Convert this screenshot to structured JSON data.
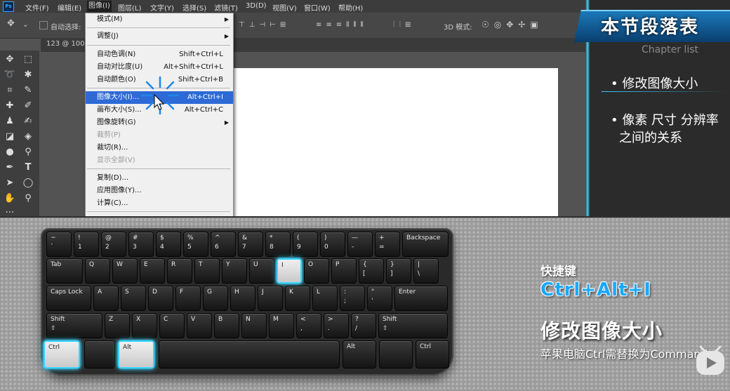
{
  "menubar": {
    "logo": "Ps",
    "items": [
      "文件(F)",
      "编辑(E)",
      "图像(I)",
      "图层(L)",
      "文字(Y)",
      "选择(S)",
      "滤镜(T)",
      "3D(D)",
      "视图(V)",
      "窗口(W)",
      "帮助(H)"
    ]
  },
  "options": {
    "auto_select": "自动选择:",
    "mode_3d": "3D 模式:"
  },
  "document": {
    "tab": "123 @ 100"
  },
  "image_menu": {
    "items": [
      {
        "label": "模式(M)",
        "shortcut": "",
        "submenu": true,
        "disabled": false
      },
      {
        "label": "调整(J)",
        "shortcut": "",
        "submenu": true,
        "disabled": false
      },
      {
        "label": "自动色调(N)",
        "shortcut": "Shift+Ctrl+L",
        "disabled": false
      },
      {
        "label": "自动对比度(U)",
        "shortcut": "Alt+Shift+Ctrl+L",
        "disabled": false
      },
      {
        "label": "自动颜色(O)",
        "shortcut": "Shift+Ctrl+B",
        "disabled": false
      },
      {
        "label": "图像大小(I)...",
        "shortcut": "Alt+Ctrl+I",
        "highlighted": true,
        "disabled": false
      },
      {
        "label": "画布大小(S)...",
        "shortcut": "Alt+Ctrl+C",
        "disabled": false
      },
      {
        "label": "图像旋转(G)",
        "shortcut": "",
        "submenu": true,
        "disabled": false
      },
      {
        "label": "裁剪(P)",
        "shortcut": "",
        "disabled": true
      },
      {
        "label": "裁切(R)...",
        "shortcut": "",
        "disabled": false
      },
      {
        "label": "显示全部(V)",
        "shortcut": "",
        "disabled": true
      },
      {
        "label": "复制(D)...",
        "shortcut": "",
        "disabled": false
      },
      {
        "label": "应用图像(Y)...",
        "shortcut": "",
        "disabled": false
      },
      {
        "label": "计算(C)...",
        "shortcut": "",
        "disabled": false
      }
    ]
  },
  "panel": {
    "title": "本节段落表",
    "subtitle": "Chapter list",
    "chapters": [
      "• 修改图像大小",
      "• 像素 尺寸 分辨率",
      "之间的关系"
    ]
  },
  "keyboard": {
    "row1": [
      [
        "~",
        "`"
      ],
      [
        "!",
        "1"
      ],
      [
        "@",
        "2"
      ],
      [
        "#",
        "3"
      ],
      [
        "$",
        "4"
      ],
      [
        "%",
        "5"
      ],
      [
        "^",
        "6"
      ],
      [
        "&",
        "7"
      ],
      [
        "*",
        "8"
      ],
      [
        "(",
        "9"
      ],
      [
        ")",
        "0"
      ],
      [
        "—",
        "-"
      ],
      [
        "+",
        "="
      ]
    ],
    "backspace": "Backspace",
    "tab": "Tab",
    "row2": [
      "Q",
      "W",
      "E",
      "R",
      "T",
      "Y",
      "U",
      "I",
      "O",
      "P"
    ],
    "row2_extra": [
      [
        "{",
        "["
      ],
      [
        "}",
        "]"
      ],
      [
        "|",
        "\\"
      ]
    ],
    "caps": "Caps Lock",
    "row3": [
      "A",
      "S",
      "D",
      "F",
      "G",
      "H",
      "J",
      "K",
      "L"
    ],
    "row3_extra": [
      [
        ":",
        ";"
      ],
      [
        "\"",
        "'"
      ]
    ],
    "enter": "Enter",
    "shift": "Shift",
    "row4": [
      "Z",
      "X",
      "C",
      "V",
      "B",
      "N",
      "M"
    ],
    "row4_extra": [
      [
        "<",
        ","
      ],
      [
        ">",
        "."
      ],
      [
        "?",
        "/"
      ]
    ],
    "ctrl": "Ctrl",
    "alt": "Alt",
    "shift_symbol": "⇧"
  },
  "shortcut": {
    "label": "快捷键",
    "combo": "Ctrl+Alt+I",
    "title": "修改图像大小",
    "note": "苹果电脑Ctrl需替换为Command"
  },
  "colors": {
    "highlight": "#2d6ad6",
    "glow": "#39d6ff",
    "combo": "#1aa8ff"
  }
}
